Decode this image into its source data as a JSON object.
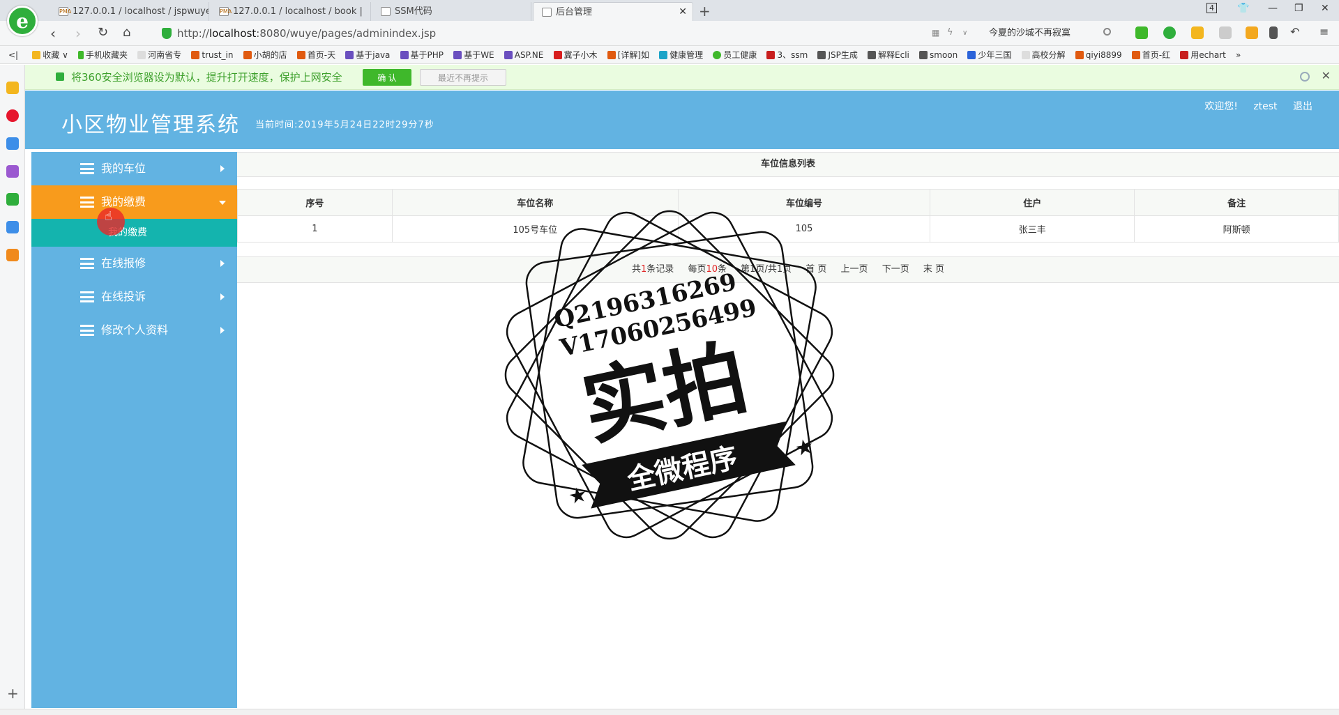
{
  "browser": {
    "tabs": [
      {
        "title": "127.0.0.1 / localhost / jspwuye",
        "icon": "PMA"
      },
      {
        "title": "127.0.0.1 / localhost / book |",
        "icon": "PMA"
      },
      {
        "title": "SSM代码",
        "icon": ""
      },
      {
        "title": "后台管理",
        "icon": ""
      }
    ],
    "tab_count": "4",
    "url_prefix": "http://",
    "url_host": "localhost",
    "url_rest": ":8080/wuye/pages/adminindex.jsp",
    "search_text": "今夏的沙城不再寂寞",
    "bookmarks": [
      "收藏",
      "手机收藏夹",
      "河南省专",
      "trust_in",
      "小胡的店",
      "首页-天",
      "基于java",
      "基于PHP",
      "基于WE",
      "ASP.NE",
      "冀子小木",
      "[详解]如",
      "健康管理",
      "员工健康",
      "3、ssm",
      "JSP生成",
      "解释Ecli",
      "smoon",
      "少年三国",
      "高校分解",
      "qiyi8899",
      "首页-红",
      "用echart"
    ]
  },
  "notice": {
    "text": "将360安全浏览器设为默认，提升打开速度，保护上网安全",
    "confirm_label": "确 认",
    "skip_label": "最近不再提示"
  },
  "header": {
    "title": "小区物业管理系统",
    "time_text": "当前时间:2019年5月24日22时29分7秒",
    "welcome": "欢迎您!",
    "username": "ztest",
    "logout": "退出"
  },
  "sidebar": {
    "items": [
      {
        "label": "我的车位"
      },
      {
        "label": "我的缴费"
      },
      {
        "label": "在线报修"
      },
      {
        "label": "在线投诉"
      },
      {
        "label": "修改个人资料"
      }
    ],
    "submenu": "我的缴费"
  },
  "main": {
    "list_title": "车位信息列表",
    "columns": [
      "序号",
      "车位名称",
      "车位编号",
      "住户",
      "备注"
    ],
    "rows": [
      [
        "1",
        "105号车位",
        "105",
        "张三丰",
        "阿斯顿"
      ]
    ],
    "pager": {
      "total_prefix": "共",
      "total_count": "1",
      "total_suffix": "条记录",
      "per_page_prefix": "每页",
      "per_page_count": "10",
      "per_page_suffix": "条",
      "page_info": "第1页/共1页",
      "first": "首 页",
      "prev": "上一页",
      "next": "下一页",
      "last": "末 页"
    }
  },
  "watermark": {
    "line1": "Q2196316269",
    "line2": "V17060256499",
    "main": "实拍",
    "banner": "全微程序"
  }
}
